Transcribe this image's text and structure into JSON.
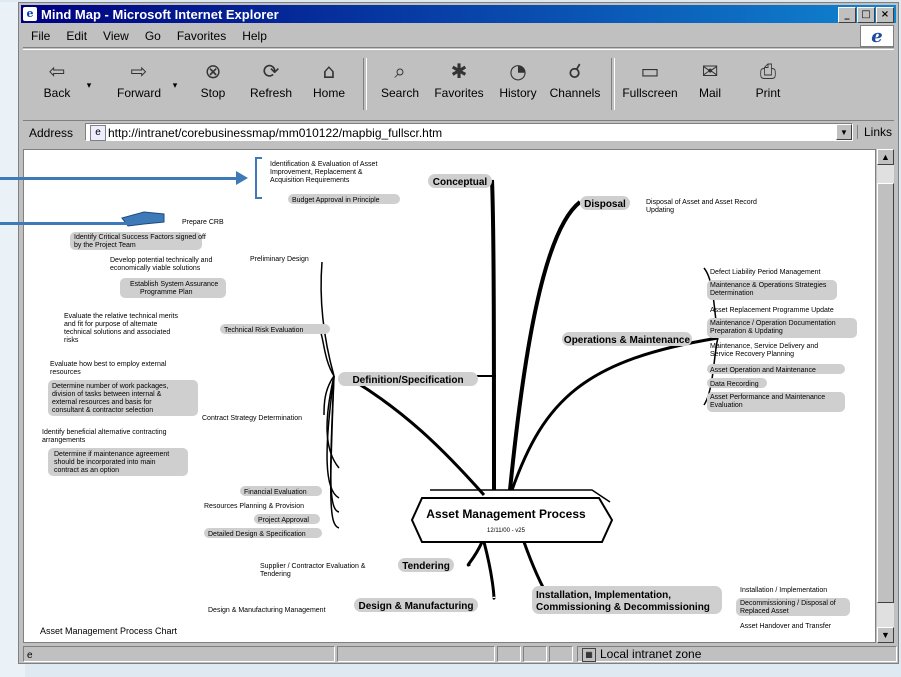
{
  "window": {
    "title": "Mind Map - Microsoft Internet Explorer",
    "controls": [
      "_",
      "□",
      "×"
    ]
  },
  "menu": [
    "File",
    "Edit",
    "View",
    "Go",
    "Favorites",
    "Help"
  ],
  "toolbar": [
    {
      "label": "Back",
      "icon": "back-arrow-icon",
      "glyph": "⇦"
    },
    {
      "label": "Forward",
      "icon": "forward-arrow-icon",
      "glyph": "⇨"
    },
    {
      "label": "Stop",
      "icon": "stop-icon",
      "glyph": "⊗"
    },
    {
      "label": "Refresh",
      "icon": "refresh-icon",
      "glyph": "⟳"
    },
    {
      "label": "Home",
      "icon": "home-icon",
      "glyph": "⌂"
    },
    {
      "label": "Search",
      "icon": "search-icon",
      "glyph": "⌕"
    },
    {
      "label": "Favorites",
      "icon": "favorites-icon",
      "glyph": "✱"
    },
    {
      "label": "History",
      "icon": "history-icon",
      "glyph": "◔"
    },
    {
      "label": "Channels",
      "icon": "channels-icon",
      "glyph": "☌"
    },
    {
      "label": "Fullscreen",
      "icon": "fullscreen-icon",
      "glyph": "▭"
    },
    {
      "label": "Mail",
      "icon": "mail-icon",
      "glyph": "✉"
    },
    {
      "label": "Print",
      "icon": "print-icon",
      "glyph": "⎙"
    }
  ],
  "address": {
    "label": "Address",
    "url": "http://intranet/corebusinessmap/mm010122/mapbig_fullscr.htm",
    "links_label": "Links"
  },
  "status": {
    "zone": "Local intranet zone"
  },
  "mindmap": {
    "center_title": "Asset Management Process",
    "center_sub": "12/11/00 - v25",
    "chart_caption": "Asset Management Process Chart",
    "branches": {
      "conceptual": {
        "title": "Conceptual",
        "items": [
          "Identification & Evaluation of Asset",
          "Improvement, Replacement &",
          "Acquisition Requirements",
          "Budget Approval in Principle"
        ]
      },
      "disposal": {
        "title": "Disposal",
        "items": [
          "Disposal of Asset and Asset Record",
          "Updating"
        ]
      },
      "operations": {
        "title": "Operations & Maintenance",
        "items": [
          "Defect Liability Period Management",
          "Maintenance & Operations Strategies",
          "Determination",
          "Asset Replacement Programme Update",
          "Maintenance / Operation Documentation",
          "Preparation & Updating",
          "Maintenance, Service Delivery and",
          "Service Recovery Planning",
          "Asset Operation and Maintenance",
          "Data Recording",
          "Asset Performance and Maintenance",
          "Evaluation"
        ]
      },
      "definition": {
        "title": "Definition/Specification",
        "preliminary": "Preliminary Design",
        "prelim_items": [
          "Prepare CRB",
          "Identify Critical Success Factors  signed off",
          "by the Project Team",
          "Develop potential technically and",
          "economically viable solutions",
          "Establish System Assurance",
          "Programme Plan"
        ],
        "risk": "Technical  Risk Evaluation",
        "risk_items": [
          "Evaluate the relative technical merits",
          "and fit for purpose of alternate",
          "technical solutions and associated",
          "risks"
        ],
        "contract": "Contract Strategy Determination",
        "contract_items": [
          "Evaluate how best to employ external",
          "resources",
          "Determine number of work packages,",
          "division of tasks between internal &",
          "external resources and basis for",
          "consultant & contractor selection",
          "Identify beneficial alternative contracting",
          "arrangements",
          "Determine if maintenance agreement",
          "should be incorporated into main",
          "contract as an option"
        ],
        "other_items": [
          "Financial Evaluation",
          "Resources Planning & Provision",
          "Project Approval",
          "Detailed Design & Specification"
        ]
      },
      "tendering": {
        "title": "Tendering",
        "items": [
          "Supplier / Contractor Evaluation  &",
          "Tendering"
        ]
      },
      "design": {
        "title": "Design & Manufacturing",
        "items": [
          "Design & Manufacturing Management"
        ]
      },
      "installation": {
        "title_l1": "Installation, Implementation,",
        "title_l2": "Commissioning & Decommissioning",
        "items": [
          "Installation / Implementation",
          "Decommissioning / Disposal of",
          "Replaced Asset",
          "Asset Handover and Transfer"
        ]
      }
    }
  }
}
